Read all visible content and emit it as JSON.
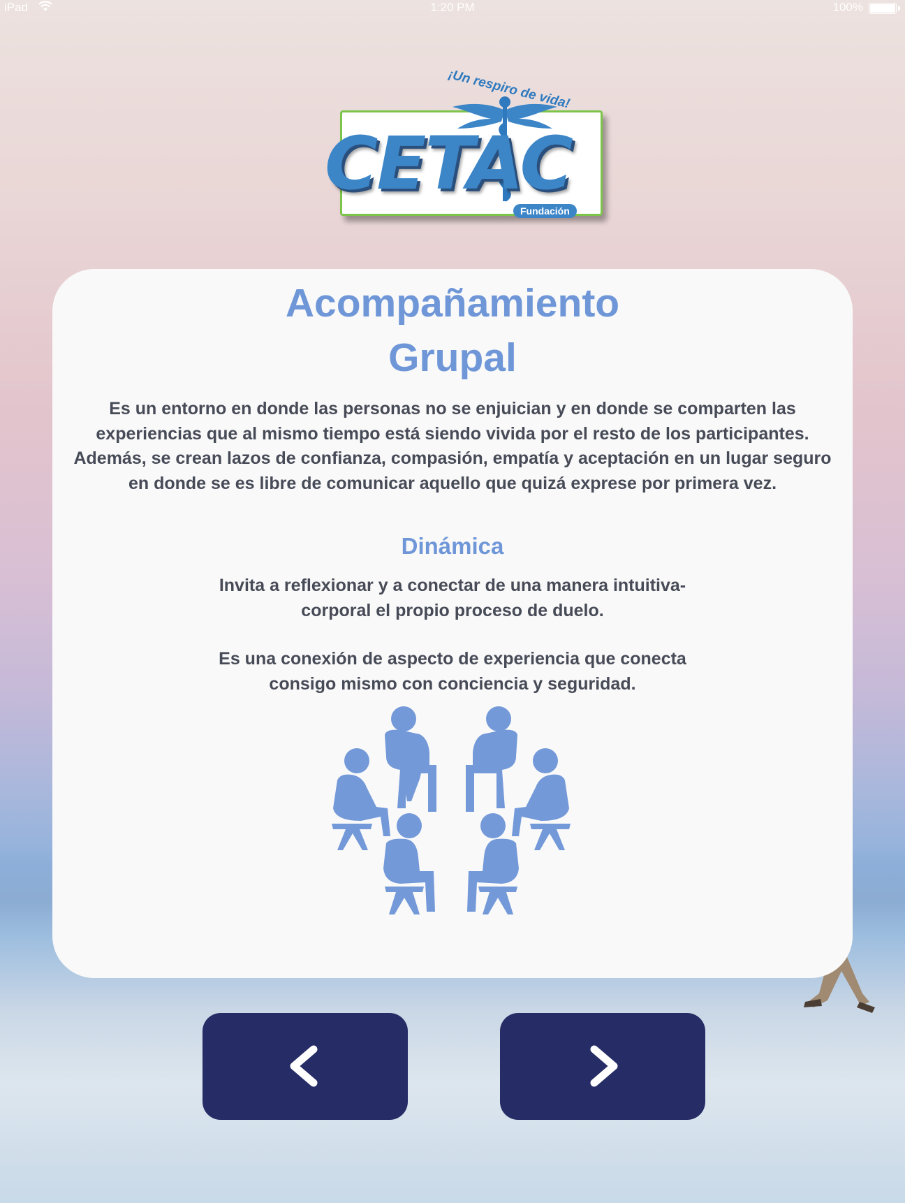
{
  "status_bar": {
    "carrier": "iPad",
    "time": "1:20 PM",
    "battery": "100%"
  },
  "logo": {
    "tagline": "¡Un respiro de vida!",
    "name": "CETAC",
    "badge": "Fundación"
  },
  "card": {
    "title_line1": "Acompañamiento",
    "title_line2": "Grupal",
    "intro": "Es un entorno en donde las personas no se enjuician y en donde se comparten las experiencias que al mismo tiempo está siendo vivida por el resto de los participantes. Además, se crean lazos de confianza, compasión, empatía y aceptación en un lugar seguro en donde se es libre de comunicar aquello que quizá exprese por primera vez.",
    "subtitle": "Dinámica",
    "paragraph1": "Invita a reflexionar y a conectar de una manera intuitiva-corporal el propio proceso de duelo.",
    "paragraph2": "Es una conexión de aspecto de experiencia que conecta consigo mismo con conciencia y seguridad.",
    "illustration": "group-circle-icon"
  },
  "navigation": {
    "prev_icon": "chevron-left-icon",
    "next_icon": "chevron-right-icon"
  },
  "colors": {
    "accent": "#6f97d8",
    "body_text": "#474b57",
    "button": "#262c66",
    "card": "#f9f9f9"
  }
}
